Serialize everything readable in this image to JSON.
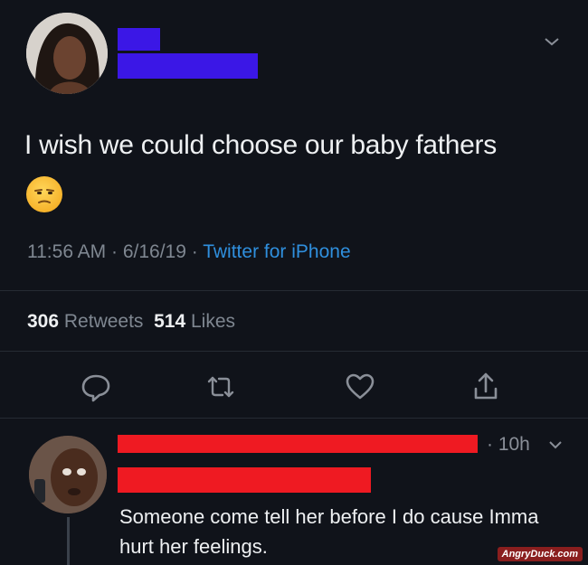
{
  "tweet": {
    "text": "I wish we could choose our baby fathers",
    "emoji": "unamused-face",
    "time": "11:56 AM",
    "date": "6/16/19",
    "source": "Twitter for iPhone",
    "retweets_count": "306",
    "retweets_label": "Retweets",
    "likes_count": "514",
    "likes_label": "Likes"
  },
  "actions": [
    "reply-icon",
    "retweet-icon",
    "like-icon",
    "share-icon"
  ],
  "reply": {
    "time": "10h",
    "text": "Someone come tell her before I do cause Imma hurt her feelings."
  },
  "watermark": "AngryDuck.com",
  "colors": {
    "background": "#10131a",
    "link": "#2f8fdd",
    "muted": "#7f8791",
    "redaction_blue": "#3b17e6",
    "redaction_red": "#ef1a22"
  }
}
